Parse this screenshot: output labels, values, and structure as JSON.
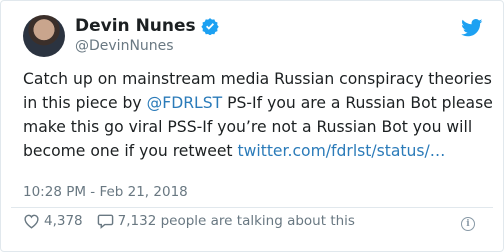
{
  "author": {
    "name": "Devin Nunes",
    "handle": "@DevinNunes",
    "verified": true
  },
  "tweet": {
    "text_part1": "Catch up on mainstream media Russian conspiracy theories in this piece by ",
    "mention": "@FDRLST",
    "text_part2": "  PS-If you are a Russian Bot please make this go viral  PSS-If you’re not a Russian Bot you will become one if you retweet ",
    "link": "twitter.com/fdrlst/status/…",
    "timestamp": "10:28 PM - Feb 21, 2018"
  },
  "stats": {
    "likes": "4,378",
    "talking": "7,132 people are talking about this"
  },
  "icons": {
    "brand": "twitter-bird-icon",
    "verified": "verified-badge-icon",
    "like": "heart-icon",
    "reply": "speech-bubble-icon",
    "info": "info-icon"
  },
  "colors": {
    "link": "#2b7bb9",
    "brand": "#1da1f2",
    "muted": "#697882"
  }
}
